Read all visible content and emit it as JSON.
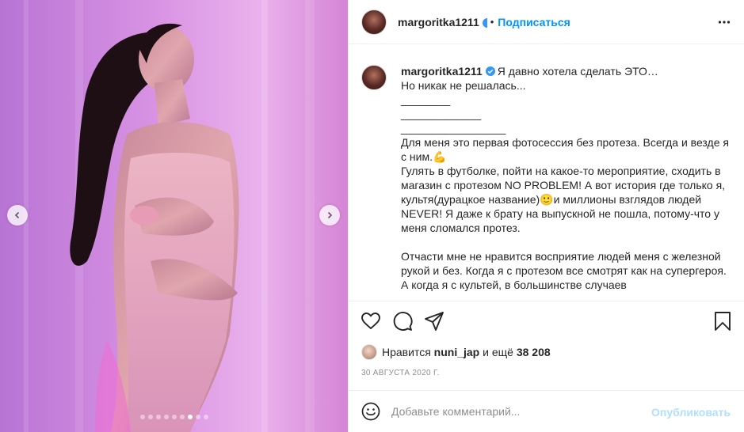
{
  "header": {
    "username": "margoritka1211",
    "separator": "•",
    "follow_label": "Подписаться",
    "more_icon": "more-horizontal-icon"
  },
  "caption": {
    "username": "margoritka1211",
    "verified_icon": "verified-badge-icon",
    "text": "Я давно хотела сделать ЭТО…\nНо никак не решалась...\n________\n_____________\n_________________\nДля меня это первая фотосессия без протеза. Всегда и везде я с ним.💪\nГулять в футболке, пойти на какое-то мероприятие, сходить в магазин с протезом NO PROBLEM! А вот история где только я, культя(дурацкое название)🙂и миллионы взглядов людей NEVER! Я даже к брату на выпускной не пошла, потому-что у меня сломался протез.\n\nОтчасти мне не нравится восприятие людей меня с железной рукой и без. Когда я с протезом все смотрят как на супергероя. А когда я с культей, в большинстве случаев"
  },
  "actions": {
    "like_icon": "heart-icon",
    "comment_icon": "comment-icon",
    "share_icon": "paper-plane-icon",
    "save_icon": "bookmark-icon"
  },
  "likes": {
    "prefix": "Нравится",
    "user": "nuni_jap",
    "connector": "и ещё",
    "count": "38 208"
  },
  "date": "30 АВГУСТА 2020 Г.",
  "comment": {
    "placeholder": "Добавьте комментарий...",
    "post_label": "Опубликовать",
    "emoji_icon": "smiley-icon"
  },
  "carousel": {
    "total": 9,
    "active_index": 6
  },
  "colors": {
    "accent": "#0095f6",
    "post_disabled": "#b2dffc",
    "meta": "#8e8e8e",
    "text": "#262626"
  }
}
